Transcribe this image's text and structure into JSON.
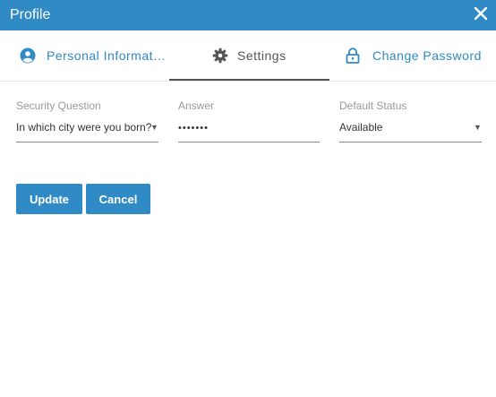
{
  "header": {
    "title": "Profile"
  },
  "tabs": [
    {
      "label": "Personal Informat…",
      "icon": "user-circle-icon"
    },
    {
      "label": "Settings",
      "icon": "gear-icon",
      "active": true
    },
    {
      "label": "Change Password",
      "icon": "lock-icon"
    }
  ],
  "form": {
    "security_question": {
      "label": "Security Question",
      "value": "In which city were you born?"
    },
    "answer": {
      "label": "Answer",
      "value": "•••••••"
    },
    "default_status": {
      "label": "Default Status",
      "value": "Available"
    }
  },
  "buttons": {
    "update": "Update",
    "cancel": "Cancel"
  },
  "colors": {
    "primary": "#2f8ac6",
    "tab_inactive": "#2f8ac6",
    "tab_active": "#555555"
  }
}
